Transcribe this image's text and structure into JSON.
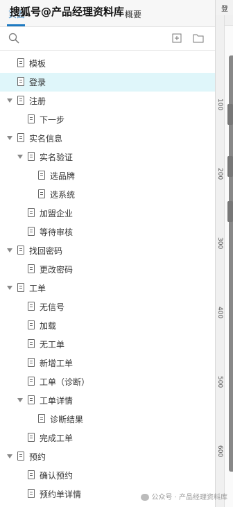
{
  "tabs": {
    "pages": "页面",
    "outline": "概要"
  },
  "watermark_top": "搜狐号@产品经理资料库",
  "ruler": {
    "top_label": "登录",
    "numbers": [
      "100",
      "200",
      "300",
      "400",
      "500",
      "600"
    ]
  },
  "tree": [
    {
      "label": "模板",
      "level": 0,
      "expanded": null,
      "selected": false
    },
    {
      "label": "登录",
      "level": 0,
      "expanded": null,
      "selected": true
    },
    {
      "label": "注册",
      "level": 0,
      "expanded": true,
      "selected": false
    },
    {
      "label": "下一步",
      "level": 1,
      "expanded": null,
      "selected": false
    },
    {
      "label": "实名信息",
      "level": 0,
      "expanded": true,
      "selected": false
    },
    {
      "label": "实名验证",
      "level": 1,
      "expanded": true,
      "selected": false
    },
    {
      "label": "选品牌",
      "level": 2,
      "expanded": null,
      "selected": false
    },
    {
      "label": "选系统",
      "level": 2,
      "expanded": null,
      "selected": false
    },
    {
      "label": "加盟企业",
      "level": 1,
      "expanded": null,
      "selected": false
    },
    {
      "label": "等待审核",
      "level": 1,
      "expanded": null,
      "selected": false
    },
    {
      "label": "找回密码",
      "level": 0,
      "expanded": true,
      "selected": false
    },
    {
      "label": "更改密码",
      "level": 1,
      "expanded": null,
      "selected": false
    },
    {
      "label": "工单",
      "level": 0,
      "expanded": true,
      "selected": false
    },
    {
      "label": "无信号",
      "level": 1,
      "expanded": null,
      "selected": false
    },
    {
      "label": "加载",
      "level": 1,
      "expanded": null,
      "selected": false
    },
    {
      "label": "无工单",
      "level": 1,
      "expanded": null,
      "selected": false
    },
    {
      "label": "新增工单",
      "level": 1,
      "expanded": null,
      "selected": false
    },
    {
      "label": "工单（诊断）",
      "level": 1,
      "expanded": null,
      "selected": false
    },
    {
      "label": "工单详情",
      "level": 1,
      "expanded": true,
      "selected": false
    },
    {
      "label": "诊断结果",
      "level": 2,
      "expanded": null,
      "selected": false
    },
    {
      "label": "完成工单",
      "level": 1,
      "expanded": null,
      "selected": false
    },
    {
      "label": "预约",
      "level": 0,
      "expanded": true,
      "selected": false
    },
    {
      "label": "确认预约",
      "level": 1,
      "expanded": null,
      "selected": false
    },
    {
      "label": "预约单详情",
      "level": 1,
      "expanded": null,
      "selected": false
    }
  ],
  "watermark_bottom": "公众号 · 产品经理资料库",
  "icons": {
    "search": "search-icon",
    "add_page": "add-page-icon",
    "add_folder": "folder-icon",
    "page": "page-icon",
    "caret": "caret-down-icon",
    "wechat": "wechat-icon"
  },
  "colors": {
    "accent": "#1e7ac2",
    "selected_row": "#dff6fa"
  }
}
